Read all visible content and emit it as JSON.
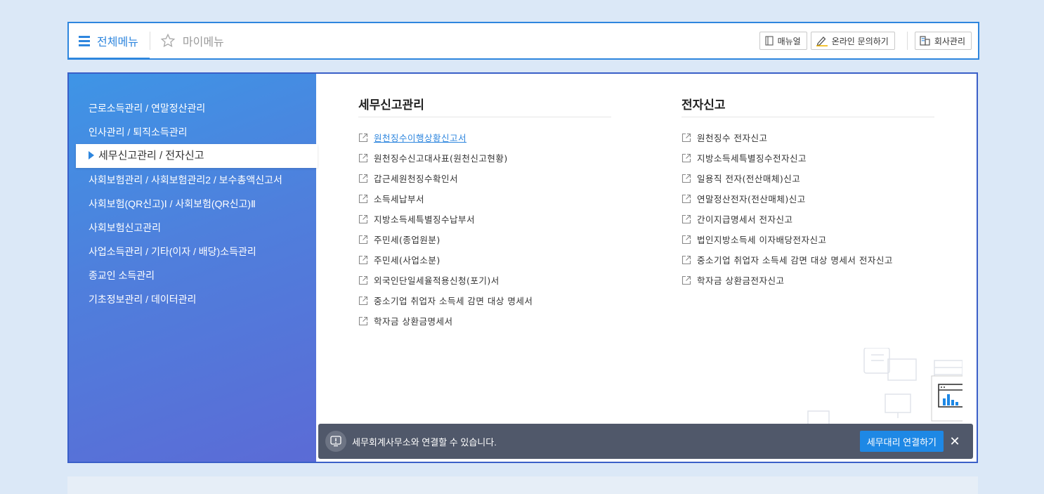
{
  "topbar": {
    "tab_all": "전체메뉴",
    "tab_my": "마이메뉴",
    "btn_manual": "매뉴얼",
    "btn_inquiry": "온라인 문의하기",
    "btn_company": "회사관리"
  },
  "sidebar": {
    "items": [
      {
        "label": "근로소득관리 / 연말정산관리"
      },
      {
        "label": "인사관리 / 퇴직소득관리"
      },
      {
        "label": "세무신고관리 / 전자신고"
      },
      {
        "label": "사회보험관리 / 사회보험관리2 / 보수총액신고서"
      },
      {
        "label": "사회보험(QR신고)Ⅰ / 사회보험(QR신고)Ⅱ"
      },
      {
        "label": "사회보험신고관리"
      },
      {
        "label": "사업소득관리 / 기타(이자 / 배당)소득관리"
      },
      {
        "label": "종교인 소득관리"
      },
      {
        "label": "기초정보관리 / 데이터관리"
      }
    ],
    "active_index": 2
  },
  "col1": {
    "title": "세무신고관리",
    "items": [
      "원천징수이행상황신고서",
      "원천징수신고대사표(원천신고현황)",
      "갑근세원천징수확인서",
      "소득세납부서",
      "지방소득세특별징수납부서",
      "주민세(종업원분)",
      "주민세(사업소분)",
      "외국인단일세율적용신청(포기)서",
      "중소기업 취업자 소득세 감면 대상 명세서",
      "학자금 상환금명세서"
    ]
  },
  "col2": {
    "title": "전자신고",
    "items": [
      "원천징수 전자신고",
      "지방소득세특별징수전자신고",
      "일용직 전자(전산매체)신고",
      "연말정산전자(전산매체)신고",
      "간이지급명세서 전자신고",
      "법인지방소득세 이자배당전자신고",
      "중소기업 취업자 소득세 감면 대상 명세서 전자신고",
      "학자금 상환금전자신고"
    ]
  },
  "notice": {
    "text": "세무회계사무소와 연결할 수 있습니다.",
    "button": "세무대리 연결하기",
    "close": "✕"
  },
  "colors": {
    "accent": "#2e86de",
    "sidebar_top": "#3e95e6",
    "sidebar_bottom": "#5b6bd6",
    "notice_bg": "#50586a",
    "notice_btn": "#1e88e5"
  }
}
